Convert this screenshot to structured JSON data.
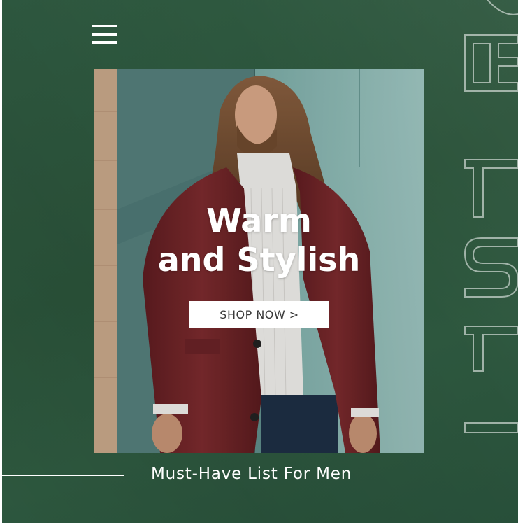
{
  "menu": {
    "icon": "hamburger-menu-icon"
  },
  "banner": {
    "headline_line1": "Warm",
    "headline_line2": "and Stylish",
    "cta_label": "SHOP NOW >",
    "image_subject": "man in burgundy overcoat and white turtleneck against stone wall"
  },
  "tagline": "Must-Have List For Men",
  "colors": {
    "background": "#2c553c",
    "accent_text": "#ffffff",
    "coat": "#7a2a2c"
  }
}
